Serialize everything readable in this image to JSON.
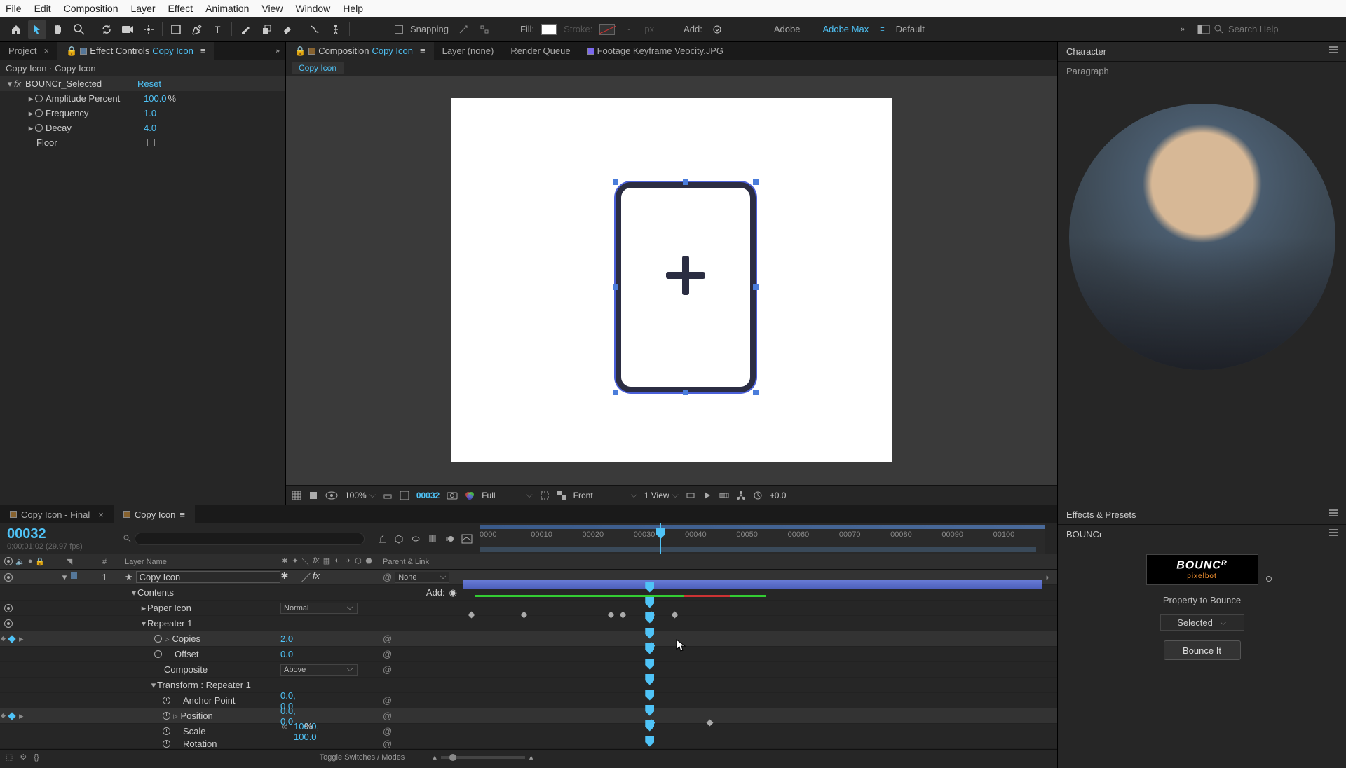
{
  "menu": [
    "File",
    "Edit",
    "Composition",
    "Layer",
    "Effect",
    "Animation",
    "View",
    "Window",
    "Help"
  ],
  "toolbar": {
    "snapping": "Snapping",
    "fill": "Fill:",
    "stroke": "Stroke:",
    "px": "px",
    "add": "Add:",
    "adobe": "Adobe",
    "adobemax": "Adobe Max",
    "default": "Default",
    "search_ph": "Search Help"
  },
  "leftTabs": {
    "project": "Project",
    "ec_prefix": "Effect Controls ",
    "ec_name": "Copy Icon"
  },
  "ec": {
    "header": "Copy Icon · Copy Icon",
    "effect": "BOUNCr_Selected",
    "reset": "Reset",
    "p1": "Amplitude Percent",
    "v1": "100.0",
    "pct": "%",
    "p2": "Frequency",
    "v2": "1.0",
    "p3": "Decay",
    "v3": "4.0",
    "p4": "Floor"
  },
  "centerTabs": {
    "comp_prefix": "Composition ",
    "comp_name": "Copy Icon",
    "layer": "Layer  (none)",
    "rq": "Render Queue",
    "footage": "Footage  Keyframe Veocity.JPG"
  },
  "breadcrumb": "Copy Icon",
  "viewerBar": {
    "zoom": "100%",
    "frame": "00032",
    "res": "Full",
    "cam": "Front",
    "views": "1 View",
    "exp": "+0.0"
  },
  "rightTabs": {
    "char": "Character",
    "para": "Paragraph"
  },
  "tlTabs": {
    "t1": "Copy Icon - Final",
    "t2": "Copy Icon"
  },
  "tlTime": {
    "frame": "00032",
    "sub": "0;00;01;02 (29.97 fps)"
  },
  "ruler": [
    "0000",
    "00010",
    "00020",
    "00030",
    "00040",
    "00050",
    "00060",
    "00070",
    "00080",
    "00090",
    "00100"
  ],
  "cols": {
    "num": "#",
    "layer": "Layer Name",
    "parent": "Parent & Link"
  },
  "layer1": {
    "num": "1",
    "name": "Copy Icon",
    "mode": "None"
  },
  "rows": {
    "contents": "Contents",
    "add": "Add:",
    "paper": "Paper Icon",
    "paperMode": "Normal",
    "rep": "Repeater 1",
    "copies": "Copies",
    "copiesV": "2.0",
    "offset": "Offset",
    "offsetV": "0.0",
    "composite": "Composite",
    "compositeV": "Above",
    "trans": "Transform : Repeater 1",
    "anchor": "Anchor Point",
    "anchorV": "0.0, 0.0",
    "position": "Position",
    "positionV": "0.0, 0.0",
    "scale": "Scale",
    "scaleV": "100.0, 100.0",
    "pct": "%",
    "rotation": "Rotation"
  },
  "tlFooter": "Toggle Switches / Modes",
  "ep": {
    "title": "Effects & Presets",
    "bouncr": "BOUNCr",
    "logo1": "BOUNC",
    "logo1r": "R",
    "logo2": "pixelbot",
    "prop": "Property to Bounce",
    "sel": "Selected",
    "btn": "Bounce It"
  }
}
